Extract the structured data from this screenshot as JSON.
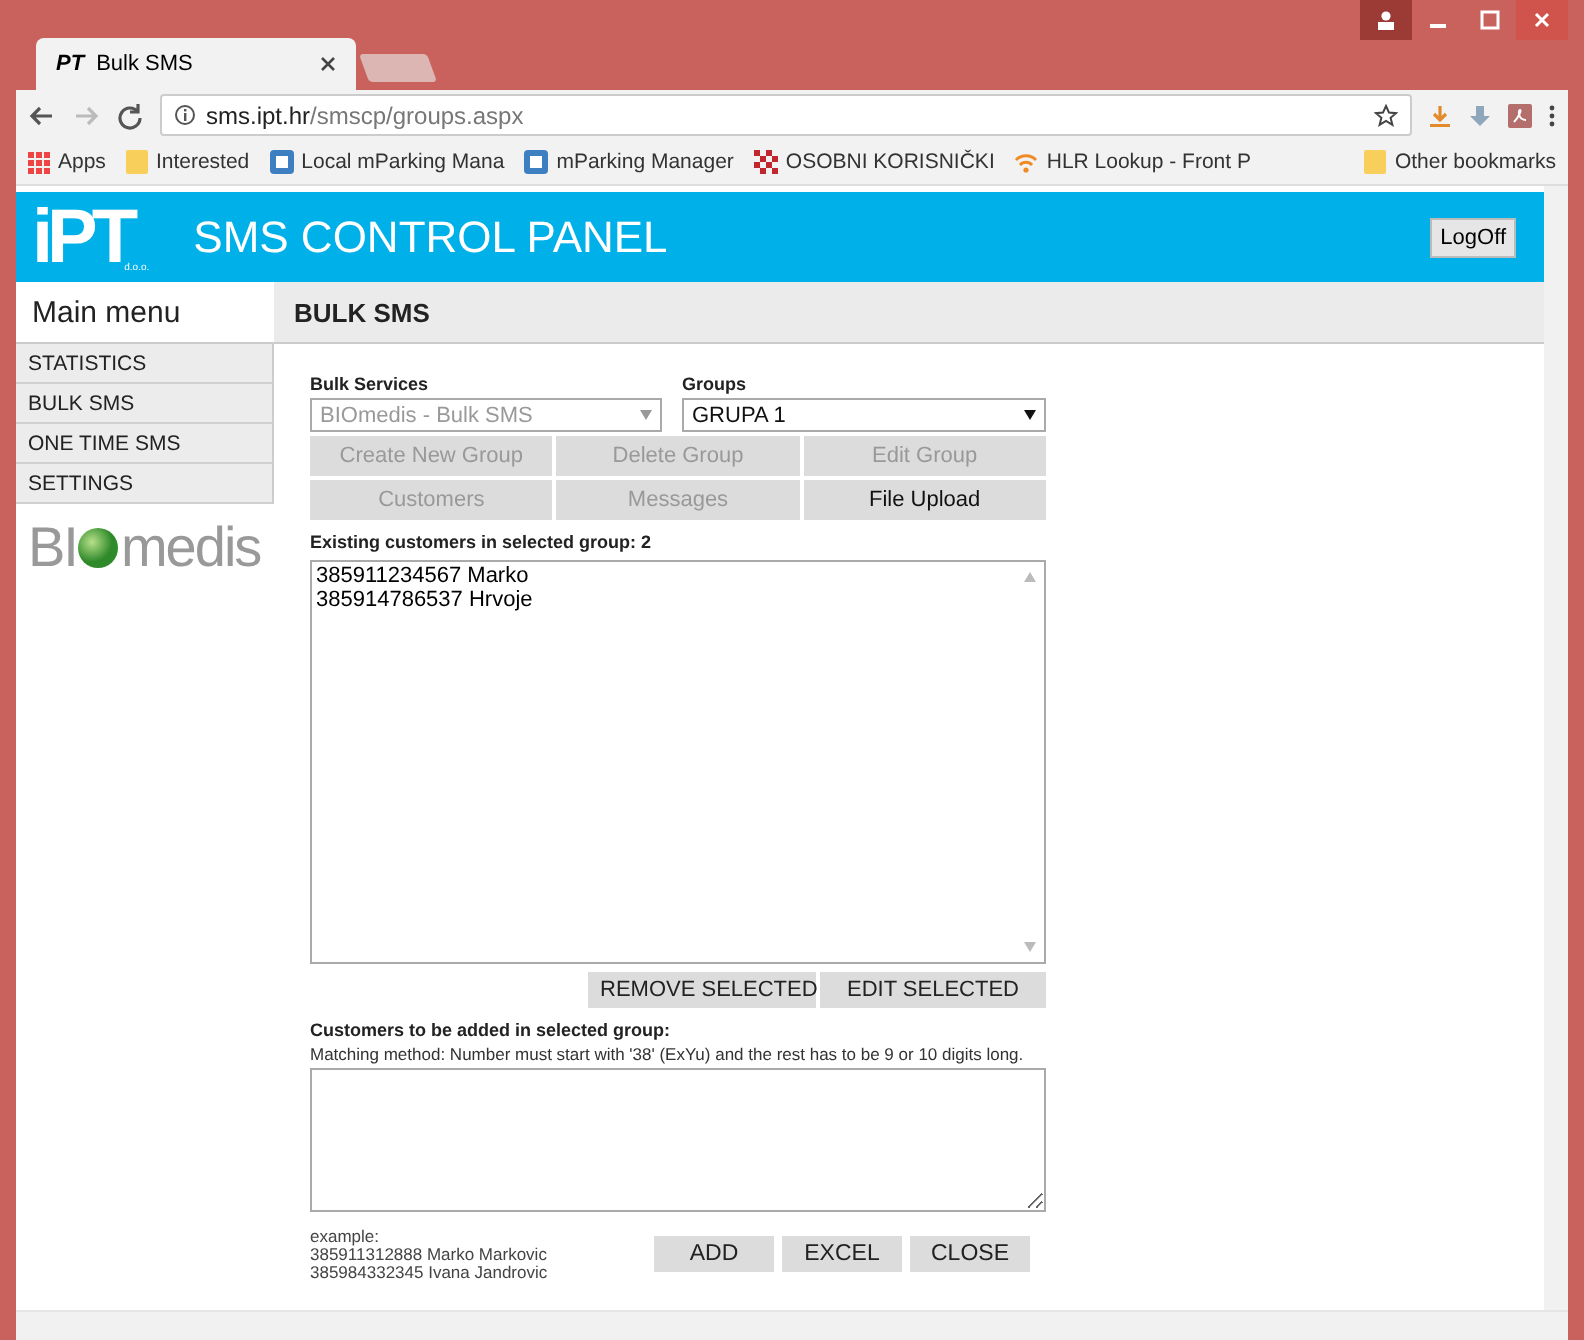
{
  "browser": {
    "tab_title": "Bulk SMS",
    "tab_logo": "PT",
    "address_host": "sms.ipt.hr",
    "address_path": "/smscp/groups.aspx",
    "bookmarks": [
      {
        "label": "Apps",
        "kind": "apps"
      },
      {
        "label": "Interested",
        "kind": "folder"
      },
      {
        "label": "Local mParking Mana",
        "kind": "app"
      },
      {
        "label": "mParking Manager",
        "kind": "app"
      },
      {
        "label": "OSOBNI KORISNIČKI",
        "kind": "checker"
      },
      {
        "label": "HLR Lookup - Front P",
        "kind": "wifi"
      }
    ],
    "other_bookmarks": "Other bookmarks"
  },
  "header": {
    "logo": "iPT",
    "logo_sub": "d.o.o.",
    "title": "SMS CONTROL PANEL",
    "logoff": "LogOff"
  },
  "sidebar": {
    "heading": "Main menu",
    "items": [
      {
        "label": "STATISTICS"
      },
      {
        "label": "BULK SMS"
      },
      {
        "label": "ONE TIME SMS"
      },
      {
        "label": "SETTINGS"
      }
    ],
    "brand_prefix": "BI",
    "brand_suffix": "medis"
  },
  "content": {
    "title": "BULK SMS",
    "bulk_services": {
      "label": "Bulk Services",
      "value": "BIOmedis - Bulk SMS",
      "disabled": true
    },
    "groups": {
      "label": "Groups",
      "value": "GRUPA 1",
      "disabled": false
    },
    "button_rows": [
      [
        {
          "label": "Create New Group",
          "disabled": true
        },
        {
          "label": "Delete Group",
          "disabled": true
        },
        {
          "label": "Edit Group",
          "disabled": true
        }
      ],
      [
        {
          "label": "Customers",
          "disabled": true
        },
        {
          "label": "Messages",
          "disabled": true
        },
        {
          "label": "File Upload",
          "disabled": false
        }
      ]
    ],
    "existing_label": "Existing customers in selected group: 2",
    "customers": [
      "385911234567 Marko",
      "385914786537 Hrvoje"
    ],
    "list_actions": [
      "REMOVE SELECTED",
      "EDIT SELECTED"
    ],
    "add_label": "Customers to be added in selected group:",
    "matching_hint": "Matching method: Number must start with '38' (ExYu) and the rest has to be 9 or 10 digits long.",
    "example": [
      "example:",
      "385911312888 Marko Markovic",
      "385984332345 Ivana Jandrovic"
    ],
    "actions": [
      "ADD",
      "EXCEL",
      "CLOSE"
    ]
  }
}
